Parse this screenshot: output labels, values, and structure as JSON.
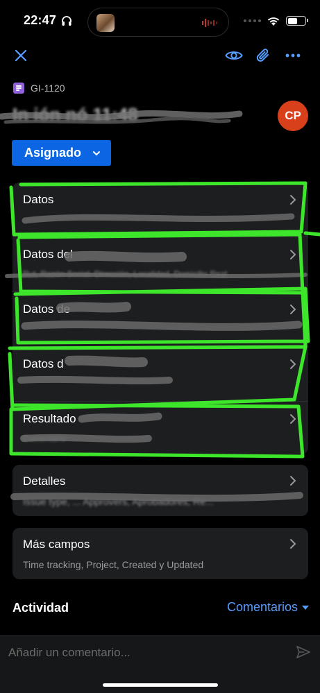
{
  "status_bar": {
    "time": "22:47"
  },
  "issue": {
    "key": "GI-1120",
    "title": "In    ión    nó    11:48",
    "assignee_initials": "CP",
    "status": "Asignado"
  },
  "fields": [
    {
      "label": "Datos",
      "value": ""
    },
    {
      "label": "Datos del",
      "value": "Rut, Razón Social, Dirección, Localidad, Domicilio Real"
    },
    {
      "label": "Datos de",
      "value": ""
    },
    {
      "label": "Datos d",
      "value": ""
    },
    {
      "label": "Resultado",
      "value": "Comentario"
    }
  ],
  "details": {
    "label": "Detalles",
    "value": "Issue type, ... Approvers, Aprobadores, Re..."
  },
  "more_fields": {
    "label": "Más campos",
    "value": "Time tracking, Project, Created y Updated"
  },
  "activity": {
    "label": "Actividad",
    "filter_label": "Comentarios"
  },
  "comment": {
    "placeholder": "Añadir un comentario..."
  },
  "colors": {
    "accent": "#579dff",
    "status_button": "#0c66e4",
    "avatar": "#d8401c",
    "highlight": "#3ee62b",
    "card_bg": "#1d1e20"
  },
  "icons": [
    "close-icon",
    "eye-icon",
    "paperclip-icon",
    "more-icon",
    "chevron-right-icon",
    "chevron-down-icon",
    "send-icon",
    "wifi-icon",
    "battery-icon",
    "headphones-icon"
  ]
}
